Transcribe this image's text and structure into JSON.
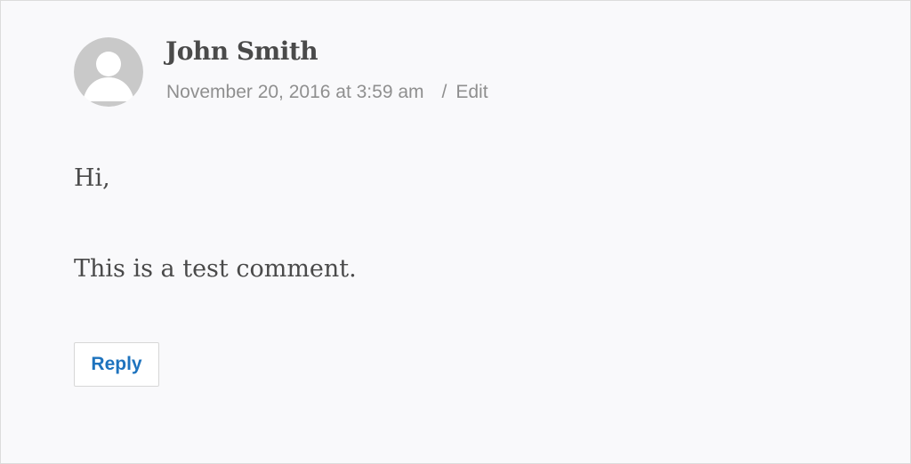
{
  "comment": {
    "avatar_icon": "default-avatar-icon",
    "author": "John Smith",
    "date": "November 20, 2016 at 3:59 am",
    "separator": "/",
    "edit_label": "Edit",
    "body": [
      "Hi,",
      "This is a test comment."
    ],
    "reply_label": "Reply"
  },
  "colors": {
    "background": "#f9f9fb",
    "text": "#4a4a4a",
    "meta": "#8f8f8f",
    "link": "#1e73be",
    "avatar": "#c9c9c9"
  }
}
